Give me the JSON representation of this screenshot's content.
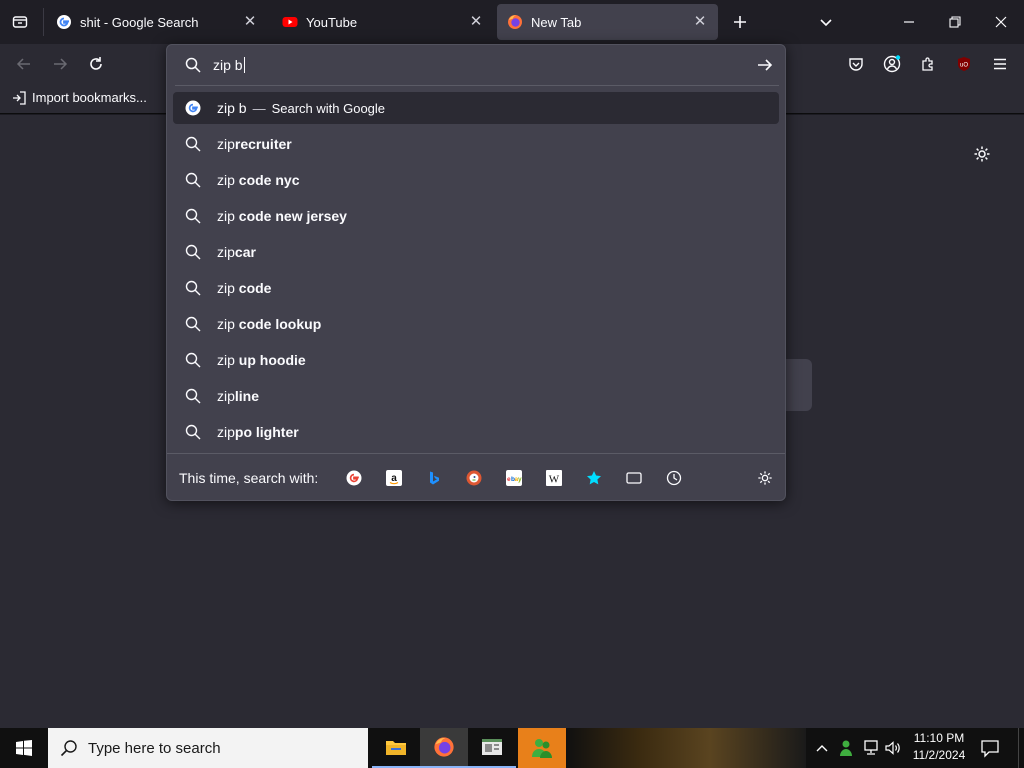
{
  "tabs": [
    {
      "title": "shit - Google Search",
      "favicon": "google-icon",
      "active": false
    },
    {
      "title": "YouTube",
      "favicon": "youtube-icon",
      "active": false
    },
    {
      "title": "New Tab",
      "favicon": "firefox-icon",
      "active": true
    }
  ],
  "bookmarks": {
    "import_label": "Import bookmarks..."
  },
  "urlbar": {
    "typed": "zip b"
  },
  "suggestions": [
    {
      "type": "search-with",
      "prefix": "zip b",
      "action": "Search with Google"
    },
    {
      "prefix": "zip",
      "bold": "recruiter"
    },
    {
      "prefix": "zip",
      "bold": " code nyc"
    },
    {
      "prefix": "zip",
      "bold": " code new jersey"
    },
    {
      "prefix": "zip",
      "bold": "car"
    },
    {
      "prefix": "zip",
      "bold": " code"
    },
    {
      "prefix": "zip",
      "bold": " code lookup"
    },
    {
      "prefix": "zip",
      "bold": " up hoodie"
    },
    {
      "prefix": "zip",
      "bold": "line"
    },
    {
      "prefix": "zip",
      "bold": "po lighter"
    }
  ],
  "oneoff": {
    "label": "This time, search with:",
    "engines": [
      "google-icon",
      "amazon-icon",
      "bing-icon",
      "duckduckgo-icon",
      "ebay-icon",
      "wikipedia-icon",
      "bookmarks-star-icon",
      "tabs-icon",
      "history-icon"
    ]
  },
  "taskbar": {
    "search_placeholder": "Type here to search",
    "time": "11:10 PM",
    "date": "11/2/2024"
  },
  "colors": {
    "accent": "#00ddff",
    "popup_bg": "#42414d",
    "content_bg": "#2b2a33",
    "selected_row": "#2b2a33"
  }
}
